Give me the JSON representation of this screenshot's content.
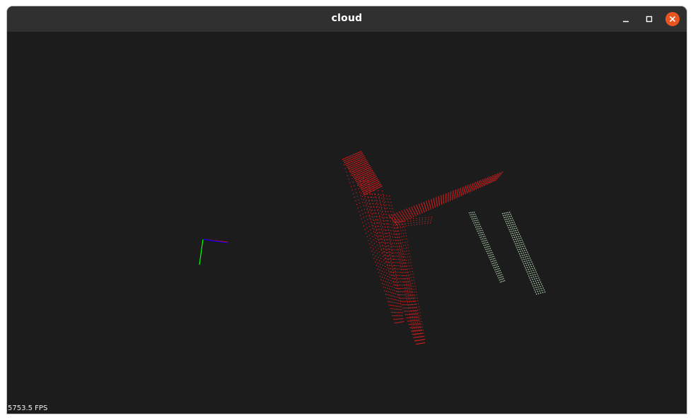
{
  "window": {
    "title": "cloud"
  },
  "titlebar_buttons": {
    "minimize": "minimize-icon",
    "maximize": "maximize-icon",
    "close": "close-icon"
  },
  "viewer": {
    "fps_text": "5753.5 FPS",
    "background_color": "#1c1c1c",
    "axes_colors": {
      "x": "#ff0000",
      "y": "#00ff00",
      "z": "#0000ff"
    },
    "clouds": [
      {
        "name": "red-cloud",
        "color": "#d21e1e"
      },
      {
        "name": "green-cloud",
        "color": "#c8f0c8"
      }
    ]
  },
  "colors": {
    "titlebar": "#303030",
    "close_button": "#e95420"
  }
}
